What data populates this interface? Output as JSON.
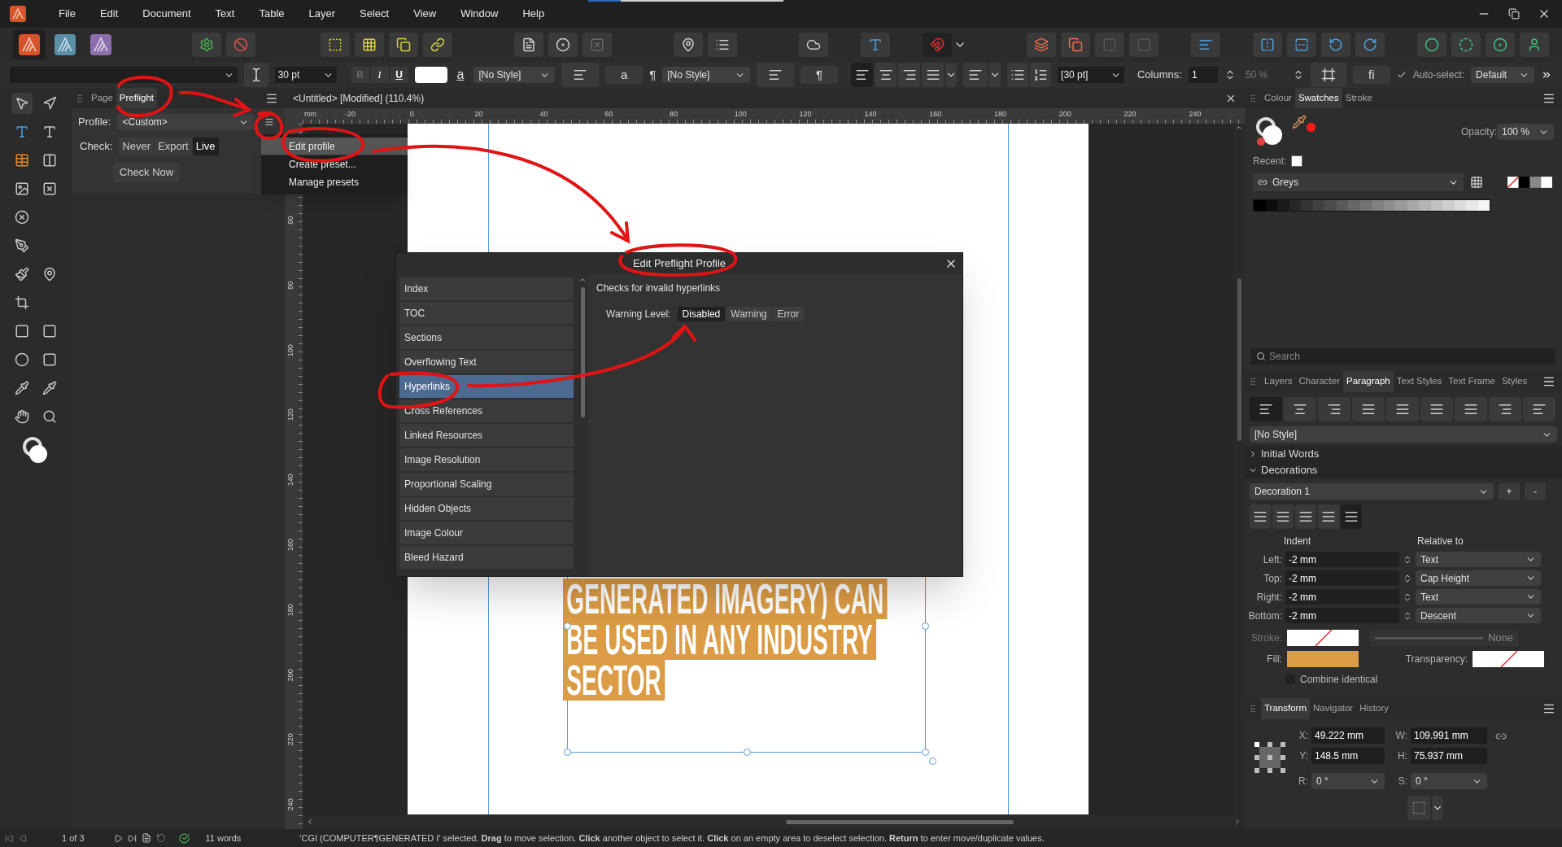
{
  "menu": [
    "File",
    "Edit",
    "Document",
    "Text",
    "Table",
    "Layer",
    "Select",
    "View",
    "Window",
    "Help"
  ],
  "context_bar": {
    "font_size": "30 pt",
    "bold": "B",
    "italic": "I",
    "underline": "U",
    "char_a": "a",
    "char_style": "[No Style]",
    "a_button": "a",
    "pilcrow": "¶",
    "para_style": "[No Style]",
    "pilcrow_button": "¶",
    "leading": "[30 pt]",
    "columns_label": "Columns:",
    "columns": "1",
    "gutter": "50 %",
    "ligature": "fi",
    "auto_select": {
      "label": "Auto-select:",
      "checked": true
    },
    "auto_select_value": "Default"
  },
  "left_panel": {
    "tabs": [
      {
        "label": "Page",
        "selected": false
      },
      {
        "label": "Preflight",
        "selected": true
      }
    ],
    "profile_label": "Profile:",
    "profile": "<Custom>",
    "check_label": "Check:",
    "check_options": [
      {
        "label": "Never",
        "selected": false
      },
      {
        "label": "Export",
        "selected": false
      },
      {
        "label": "Live",
        "selected": true
      }
    ],
    "check_now": "Check Now",
    "menu": [
      {
        "label": "Edit profile",
        "selected": true
      },
      {
        "label": "Create preset...",
        "selected": false
      },
      {
        "label": "Manage presets",
        "selected": false
      }
    ]
  },
  "document": {
    "title": "<Untitled> [Modified] (110.4%)",
    "ruler_unit": "mm",
    "h_ticks": [
      "-20",
      "0",
      "20",
      "40",
      "60",
      "80",
      "100",
      "120",
      "140",
      "160",
      "180",
      "200",
      "220",
      "240"
    ],
    "v_ticks": [
      "60",
      "80",
      "100",
      "120",
      "140",
      "160",
      "180",
      "200",
      "220",
      "240"
    ],
    "text_lines": [
      "GENERATED IMAGERY) CAN",
      "BE USED IN ANY INDUSTRY",
      "SECTOR"
    ]
  },
  "dialog": {
    "title": "Edit Preflight Profile",
    "checks": [
      {
        "label": "Index",
        "selected": false
      },
      {
        "label": "TOC",
        "selected": false
      },
      {
        "label": "Sections",
        "selected": false
      },
      {
        "label": "Overflowing Text",
        "selected": false
      },
      {
        "label": "Hyperlinks",
        "selected": true
      },
      {
        "label": "Cross References",
        "selected": false
      },
      {
        "label": "Linked Resources",
        "selected": false
      },
      {
        "label": "Image Resolution",
        "selected": false
      },
      {
        "label": "Proportional Scaling",
        "selected": false
      },
      {
        "label": "Hidden Objects",
        "selected": false
      },
      {
        "label": "Image Colour",
        "selected": false
      },
      {
        "label": "Bleed Hazard",
        "selected": false
      }
    ],
    "description": "Checks for invalid hyperlinks",
    "level_label": "Warning Level:",
    "levels": [
      {
        "label": "Disabled",
        "selected": true
      },
      {
        "label": "Warning",
        "selected": false
      },
      {
        "label": "Error",
        "selected": false
      }
    ]
  },
  "right_panel": {
    "top_tabs": [
      {
        "label": "Colour",
        "selected": false
      },
      {
        "label": "Swatches",
        "selected": true
      },
      {
        "label": "Stroke",
        "selected": false
      }
    ],
    "opacity_label": "Opacity:",
    "opacity": "100 %",
    "recent_label": "Recent:",
    "palette": "Greys",
    "search_placeholder": "Search",
    "mid_tabs": [
      {
        "label": "Layers",
        "selected": false
      },
      {
        "label": "Character",
        "selected": false
      },
      {
        "label": "Paragraph",
        "selected": true
      },
      {
        "label": "Text Styles",
        "selected": false
      },
      {
        "label": "Text Frame",
        "selected": false
      },
      {
        "label": "Styles",
        "selected": false
      }
    ],
    "para_style": "[No Style]",
    "sections": [
      {
        "label": "Initial Words",
        "expanded": false
      },
      {
        "label": "Decorations",
        "expanded": true
      }
    ],
    "decoration": "Decoration 1",
    "add": "+",
    "remove": "-",
    "indent_heading": "Indent",
    "relative_heading": "Relative to",
    "indents": [
      {
        "label": "Left:",
        "value": "-2 mm",
        "relative": "Text"
      },
      {
        "label": "Top:",
        "value": "-2 mm",
        "relative": "Cap Height"
      },
      {
        "label": "Right:",
        "value": "-2 mm",
        "relative": "Text"
      },
      {
        "label": "Bottom:",
        "value": "-2 mm",
        "relative": "Descent"
      }
    ],
    "stroke_label": "Stroke:",
    "stroke_width": "None",
    "stroke_slider": {
      "level": 0
    },
    "fill_label": "Fill:",
    "transparency_label": "Transparency:",
    "combine": {
      "label": "Combine identical",
      "checked": false
    },
    "bottom_tabs": [
      {
        "label": "Transform",
        "selected": true
      },
      {
        "label": "Navigator",
        "selected": false
      },
      {
        "label": "History",
        "selected": false
      }
    ],
    "transform": [
      {
        "label": "X:",
        "value": "49.222 mm"
      },
      {
        "label": "W:",
        "value": "109.991 mm"
      },
      {
        "label": "Y:",
        "value": "148.5 mm"
      },
      {
        "label": "H:",
        "value": "75.937 mm"
      }
    ],
    "rotation": [
      {
        "label": "R:",
        "value": "0 °"
      },
      {
        "label": "S:",
        "value": "0 °"
      }
    ]
  },
  "status_bar": {
    "page": "1 of 3",
    "words": "11 words",
    "message": "'CGI (COMPUTER¶GENERATED I' selected. **Drag** to move selection. **Click** another object to select it. **Click** on an empty area to deselect selection. **Return** to enter move/duplicate values."
  }
}
